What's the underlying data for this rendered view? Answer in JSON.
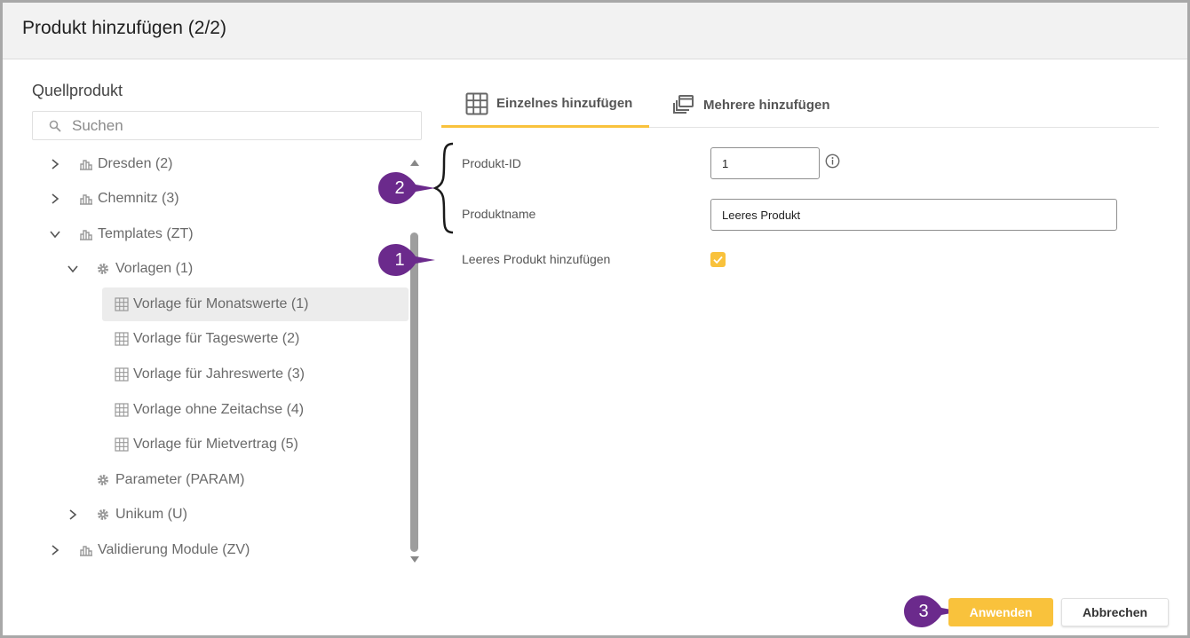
{
  "dialog": {
    "title": "Produkt hinzufügen (2/2)"
  },
  "source": {
    "label": "Quellprodukt",
    "search_placeholder": "Suchen",
    "tree": [
      {
        "label": "Dresden (2)",
        "icon": "building-icon",
        "expander": "collapsed"
      },
      {
        "label": "Chemnitz (3)",
        "icon": "building-icon",
        "expander": "collapsed"
      },
      {
        "label": "Templates (ZT)",
        "icon": "building-icon",
        "expander": "expanded"
      },
      {
        "label": "Vorlagen (1)",
        "icon": "gear-icon",
        "expander": "expanded"
      },
      {
        "label": "Vorlage für Monatswerte (1)",
        "icon": "grid-icon",
        "selected": true
      },
      {
        "label": "Vorlage für Tageswerte (2)",
        "icon": "grid-icon"
      },
      {
        "label": "Vorlage für Jahreswerte (3)",
        "icon": "grid-icon"
      },
      {
        "label": "Vorlage ohne Zeitachse (4)",
        "icon": "grid-icon"
      },
      {
        "label": "Vorlage für Mietvertrag (5)",
        "icon": "grid-icon"
      },
      {
        "label": "Parameter (PARAM)",
        "icon": "gear-icon"
      },
      {
        "label": "Unikum (U)",
        "icon": "gear-icon",
        "expander": "collapsed"
      },
      {
        "label": "Validierung Module (ZV)",
        "icon": "building-icon",
        "expander": "collapsed"
      }
    ]
  },
  "tabs": [
    {
      "label": "Einzelnes hinzufügen",
      "icon": "grid-icon",
      "active": true
    },
    {
      "label": "Mehrere hinzufügen",
      "icon": "stacked-windows-icon",
      "active": false
    }
  ],
  "form": {
    "product_id_label": "Produkt-ID",
    "product_id_value": "1",
    "product_name_label": "Produktname",
    "product_name_value": "Leeres Produkt",
    "empty_product_label": "Leeres Produkt hinzufügen",
    "empty_product_checked": true
  },
  "callouts": {
    "one": "1",
    "two": "2",
    "three": "3"
  },
  "buttons": {
    "apply": "Anwenden",
    "cancel": "Abbrechen"
  },
  "colors": {
    "accent": "#f9c23c",
    "callout": "#6b2a8c"
  }
}
